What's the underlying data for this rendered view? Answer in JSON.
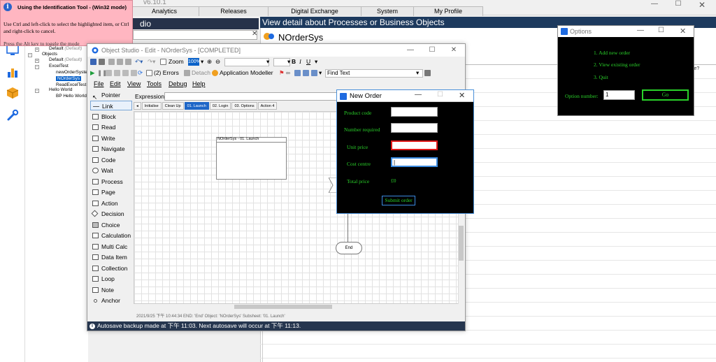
{
  "background": {
    "version": "v6.10.1",
    "tabs": [
      "Analytics",
      "Releases",
      "Digital Exchange",
      "System",
      "My Profile"
    ],
    "studio_header": "dio",
    "search_clear": "✕",
    "detail_header": "View detail about Processes or Business Objects",
    "object_name": "NOrderSys",
    "truncated_text": "ble?",
    "tree": {
      "default_top": "Default",
      "default_top_muted": "(Default)",
      "objects": "Objects",
      "default_obj": "Default",
      "default_obj_muted": "(Default)",
      "excel_test": "ExcelTest",
      "new_order_system": "newOrderSystem",
      "norder_selected": "NOrderSys",
      "read_excel_test": "ReadExcelTest",
      "hello_world": "Hello World",
      "bp_hello_world": "BP Hello World"
    }
  },
  "id_tool": {
    "title": "Using the Identification Tool - (Win32 mode)",
    "text": "Use Ctrl and left-click to select the highlighted item, or Ctrl and right-click to cancel.",
    "cut_text": "Press the Alt key to toggle the mode"
  },
  "object_studio": {
    "title": "Object Studio - Edit - NOrderSys - [COMPLETED]",
    "zoom_label": "Zoom",
    "zoom_value": "100%",
    "errors_label": "(2) Errors",
    "detach_label": "Detach",
    "app_modeller_label": "Application Modeller",
    "find_text": "Find Text",
    "menu": [
      "File",
      "Edit",
      "View",
      "Tools",
      "Debug",
      "Help"
    ],
    "palette": [
      "Pointer",
      "Link",
      "Block",
      "Read",
      "Write",
      "Navigate",
      "Code",
      "Wait",
      "Process",
      "Page",
      "Action",
      "Decision",
      "Choice",
      "Calculation",
      "Multi Calc",
      "Data Item",
      "Collection",
      "Loop",
      "Note",
      "Anchor"
    ],
    "selected_palette": "Link",
    "expression_label": "Expression:",
    "page_tabs": [
      "Initialise",
      "Clean Up",
      "01. Launch",
      "02. Login",
      "03. Options",
      "Action 4"
    ],
    "active_page_tab": "01. Launch",
    "canvas_block_title": "NOrderSys - 01. Launch",
    "canvas_end_label": "End",
    "log_line": "2021/9/25 下午 10:44:34 END: 'End'  Object: 'NOrderSys'  Subsheet: '01. Launch'",
    "status": "Autosave backup made at 下午 11:03. Next autosave will occur at 下午 11:13."
  },
  "new_order": {
    "title": "New Order",
    "product_code_label": "Product code",
    "number_required_label": "Number required",
    "unit_price_label": "Unit price",
    "cost_centre_label": "Cost centre",
    "total_price_label": "Total price",
    "total_price_value": "£0",
    "cost_centre_value": "|",
    "submit_label": "Submit order"
  },
  "options": {
    "title": "Options",
    "items": [
      "1. Add new order",
      "2. View existing order",
      "3. Quit"
    ],
    "option_number_label": "Option number:",
    "option_number_value": "1",
    "go_label": "Go"
  },
  "colors": {
    "terminal_green": "#2ad12a",
    "status_bar": "#26364f",
    "highlight_red": "#e01818",
    "tooltip_pink": "#ffb6c1"
  }
}
